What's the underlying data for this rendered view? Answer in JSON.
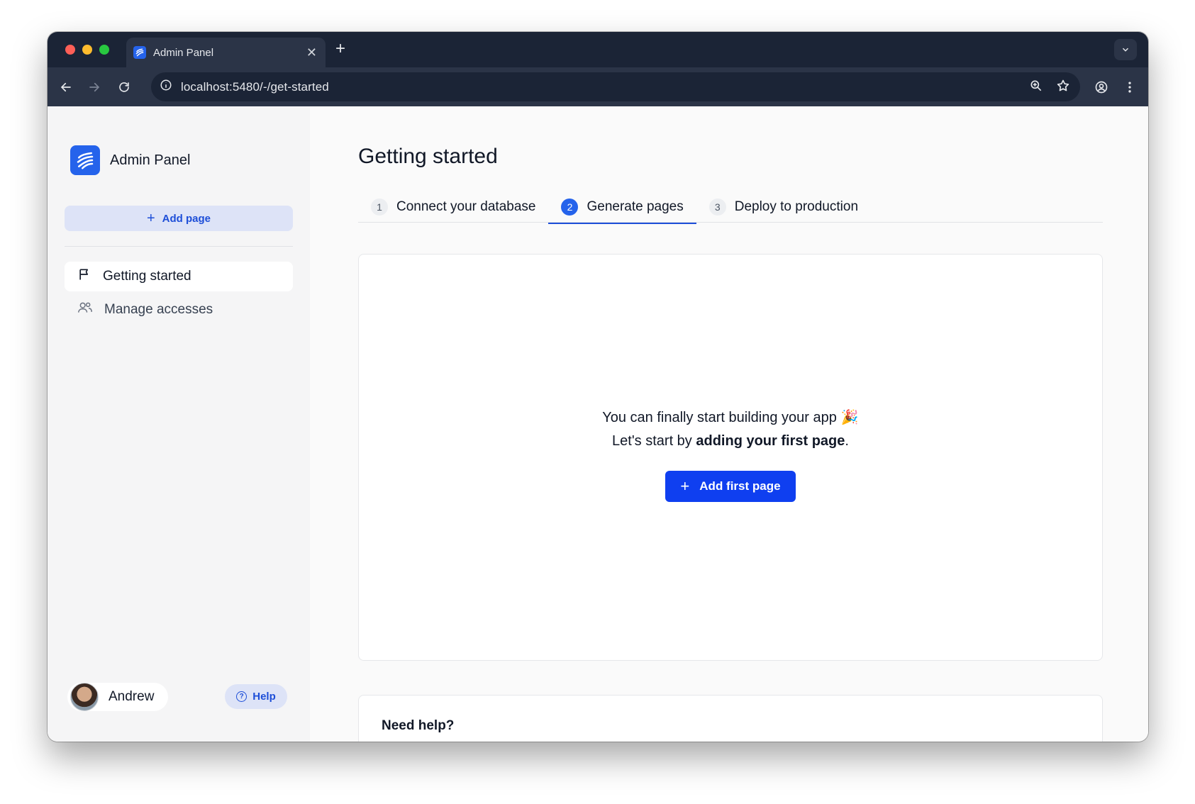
{
  "browser": {
    "tab_title": "Admin Panel",
    "url": "localhost:5480/-/get-started"
  },
  "sidebar": {
    "brand_name": "Admin Panel",
    "add_page_label": "Add page",
    "items": [
      {
        "label": "Getting started",
        "icon": "flag-icon",
        "active": true
      },
      {
        "label": "Manage accesses",
        "icon": "users-icon",
        "active": false
      }
    ],
    "user_name": "Andrew",
    "help_label": "Help"
  },
  "main": {
    "title": "Getting started",
    "steps": [
      {
        "number": "1",
        "label": "Connect your database",
        "active": false
      },
      {
        "number": "2",
        "label": "Generate pages",
        "active": true
      },
      {
        "number": "3",
        "label": "Deploy to production",
        "active": false
      }
    ],
    "card": {
      "line1": "You can finally start building your app",
      "line2_prefix": "Let's start by ",
      "line2_bold": "adding your first page",
      "line2_suffix": ".",
      "emoji": "🎉",
      "cta_label": "Add first page"
    },
    "help_card_title": "Need help?"
  },
  "colors": {
    "accent": "#2563eb",
    "cta": "#0f3ff0",
    "chrome_dark": "#1b2436"
  }
}
